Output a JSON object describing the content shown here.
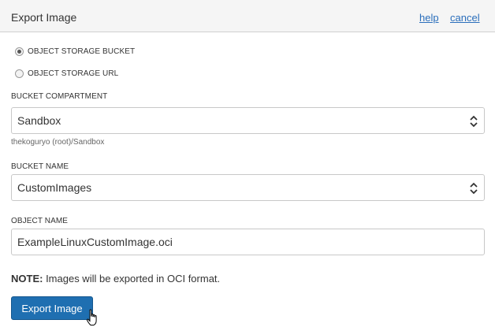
{
  "dialog": {
    "title": "Export Image",
    "help_label": "help",
    "cancel_label": "cancel"
  },
  "source_options": [
    {
      "label": "OBJECT STORAGE BUCKET",
      "selected": true
    },
    {
      "label": "OBJECT STORAGE URL",
      "selected": false
    }
  ],
  "bucket_compartment": {
    "label": "BUCKET COMPARTMENT",
    "value": "Sandbox",
    "path": "thekoguryo (root)/Sandbox"
  },
  "bucket_name": {
    "label": "BUCKET NAME",
    "value": "CustomImages"
  },
  "object_name": {
    "label": "OBJECT NAME",
    "value": "ExampleLinuxCustomImage.oci"
  },
  "note": {
    "prefix": "NOTE:",
    "text": " Images will be exported in OCI format."
  },
  "actions": {
    "export_label": "Export Image"
  },
  "colors": {
    "primary": "#1f6fb1",
    "link": "#2a6ebb"
  },
  "icons": {
    "select_arrow": "chevron-up-down-icon",
    "pointer": "hand-cursor-icon"
  }
}
